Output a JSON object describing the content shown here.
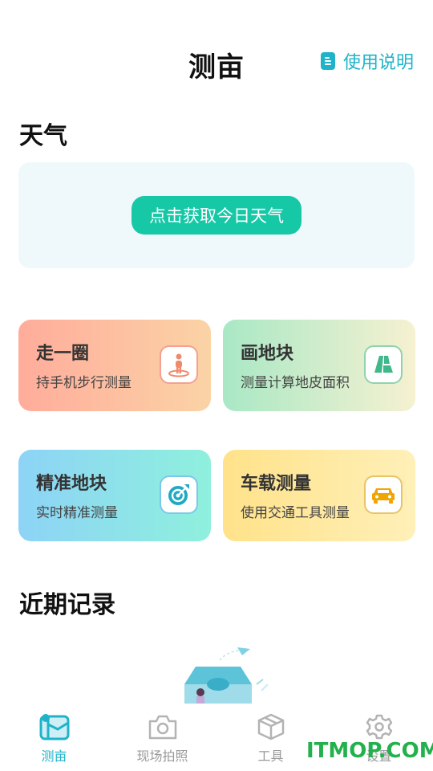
{
  "header": {
    "title": "测亩",
    "help_label": "使用说明"
  },
  "weather": {
    "section_title": "天气",
    "button_label": "点击获取今日天气"
  },
  "features": [
    {
      "name": "走一圈",
      "desc": "持手机步行测量",
      "icon": "walking-person-icon"
    },
    {
      "name": "画地块",
      "desc": "测量计算地皮面积",
      "icon": "map-plot-icon"
    },
    {
      "name": "精准地块",
      "desc": "实时精准测量",
      "icon": "target-icon"
    },
    {
      "name": "车载测量",
      "desc": "使用交通工具测量",
      "icon": "car-icon"
    }
  ],
  "records": {
    "section_title": "近期记录"
  },
  "tabs": [
    {
      "label": "测亩",
      "icon": "map-icon",
      "active": true
    },
    {
      "label": "现场拍照",
      "icon": "camera-icon",
      "active": false
    },
    {
      "label": "工具",
      "icon": "box-icon",
      "active": false
    },
    {
      "label": "设置",
      "icon": "gear-icon",
      "active": false
    }
  ],
  "watermark": "ITMOP.COM",
  "colors": {
    "accent": "#1fb3c9",
    "button": "#17c8a6"
  }
}
